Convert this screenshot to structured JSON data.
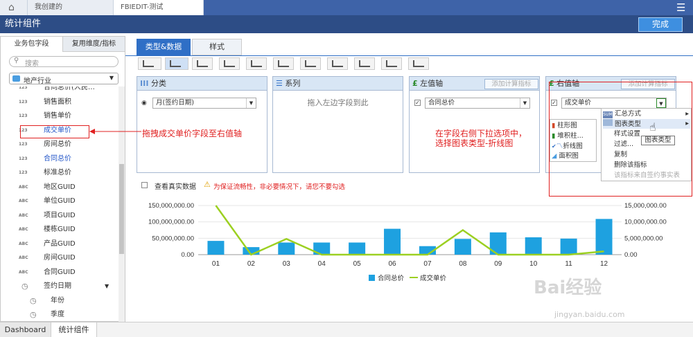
{
  "tabs": {
    "home": "",
    "mine": "我创建的",
    "edit": "FBIEDIT-测试"
  },
  "title": "统计组件",
  "done": "完成",
  "left": {
    "tab1": "业务包字段",
    "tab2": "复用维度/指标",
    "search": "搜索",
    "industry": "地产行业",
    "fields": [
      {
        "icon": "123",
        "label": "合同总价(人民…",
        "color": "#333"
      },
      {
        "icon": "123",
        "label": "销售面积",
        "color": "#333"
      },
      {
        "icon": "123",
        "label": "销售单价",
        "color": "#333"
      },
      {
        "icon": "123",
        "label": "成交单价",
        "color": "#2356c8"
      },
      {
        "icon": "123",
        "label": "房间总价",
        "color": "#333"
      },
      {
        "icon": "123",
        "label": "合同总价",
        "color": "#2356c8"
      },
      {
        "icon": "123",
        "label": "标准总价",
        "color": "#333"
      },
      {
        "icon": "ABC",
        "label": "地区GUID",
        "color": "#333"
      },
      {
        "icon": "ABC",
        "label": "单位GUID",
        "color": "#333"
      },
      {
        "icon": "ABC",
        "label": "项目GUID",
        "color": "#333"
      },
      {
        "icon": "ABC",
        "label": "楼栋GUID",
        "color": "#333"
      },
      {
        "icon": "ABC",
        "label": "产品GUID",
        "color": "#333"
      },
      {
        "icon": "ABC",
        "label": "房间GUID",
        "color": "#333"
      },
      {
        "icon": "ABC",
        "label": "合同GUID",
        "color": "#333"
      },
      {
        "icon": "◷",
        "label": "签约日期",
        "color": "#333"
      },
      {
        "icon": "◷",
        "label": "年份",
        "color": "#333"
      },
      {
        "icon": "◷",
        "label": "季度",
        "color": "#333"
      }
    ]
  },
  "rtabs": {
    "t1": "类型&数据",
    "t2": "样式"
  },
  "panels": {
    "cat": "分类",
    "series": "系列",
    "left": "左值轴",
    "right": "右值轴",
    "add": "添加计算指标",
    "drop": "拖入左边字段到此",
    "catVal": "月(签约日期)",
    "leftVal": "合同总价",
    "rightVal": "成交单价"
  },
  "menu": {
    "items": [
      "汇总方式",
      "图表类型",
      "样式设置",
      "过滤...",
      "复制",
      "删除该指标",
      "该指标来自签约事实表"
    ],
    "tip": "图表类型",
    "sub": [
      "柱形图",
      "堆积柱...",
      "折线图",
      "面积图"
    ]
  },
  "annot": {
    "a1": "拖拽成交单价字段至右值轴",
    "a2": "在字段右侧下拉选项中，",
    "a3": "选择图表类型-折线图"
  },
  "realdata": "查看真实数据",
  "warn": "为保证流畅性，非必要情况下，请您不要勾选",
  "chart_data": {
    "type": "bar",
    "categories": [
      "01",
      "02",
      "03",
      "04",
      "05",
      "06",
      "07",
      "08",
      "09",
      "10",
      "11",
      "12"
    ],
    "series": [
      {
        "name": "合同总价",
        "values": [
          42000000,
          23000000,
          37000000,
          37000000,
          37000000,
          79000000,
          26000000,
          48000000,
          68000000,
          53000000,
          49000000,
          109000000
        ]
      },
      {
        "name": "成交单价",
        "values": [
          15000000,
          0,
          4800000,
          0,
          0,
          0,
          0,
          7500000,
          0,
          0,
          0,
          1000000
        ]
      }
    ],
    "yTicks": [
      "150,000,000.00",
      "100,000,000.00",
      "50,000,000.00",
      "0.00"
    ],
    "y2Ticks": [
      "15,000,000.00",
      "10,000,000.00",
      "5,000,000.00",
      "0.00"
    ],
    "ylim": [
      0,
      150000000
    ],
    "y2lim": [
      0,
      15000000
    ],
    "barColor": "#1ea1e0",
    "lineColor": "#9cd021"
  },
  "bottom": {
    "b1": "Dashboard",
    "b2": "统计组件"
  },
  "watermark": {
    "w1": "Bai经验",
    "w2": "jingyan.baidu.com"
  }
}
